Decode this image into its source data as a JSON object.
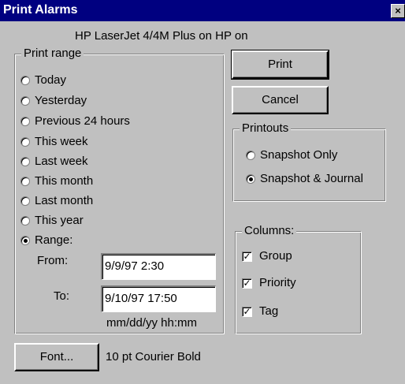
{
  "window": {
    "title": "Print Alarms",
    "close_glyph": "×"
  },
  "printer": "HP LaserJet 4/4M Plus on HP on",
  "print_range": {
    "label": "Print range",
    "options": [
      {
        "label": "Today",
        "selected": false
      },
      {
        "label": "Yesterday",
        "selected": false
      },
      {
        "label": "Previous 24 hours",
        "selected": false
      },
      {
        "label": "This week",
        "selected": false
      },
      {
        "label": "Last week",
        "selected": false
      },
      {
        "label": "This month",
        "selected": false
      },
      {
        "label": "Last month",
        "selected": false
      },
      {
        "label": "This year",
        "selected": false
      },
      {
        "label": "Range:",
        "selected": true
      }
    ],
    "from_label": "From:",
    "from_value": "9/9/97 2:30",
    "to_label": "To:",
    "to_value": "9/10/97 17:50",
    "format_hint": "mm/dd/yy hh:mm"
  },
  "buttons": {
    "print": "Print",
    "cancel": "Cancel",
    "font": "Font..."
  },
  "font_desc": "10 pt Courier Bold",
  "printouts": {
    "label": "Printouts",
    "options": [
      {
        "label": "Snapshot Only",
        "selected": false
      },
      {
        "label": "Snapshot & Journal",
        "selected": true
      }
    ]
  },
  "columns": {
    "label": "Columns:",
    "items": [
      {
        "label": "Group",
        "checked": true
      },
      {
        "label": "Priority",
        "checked": true
      },
      {
        "label": "Tag",
        "checked": true
      }
    ],
    "check_glyph": "✓"
  }
}
